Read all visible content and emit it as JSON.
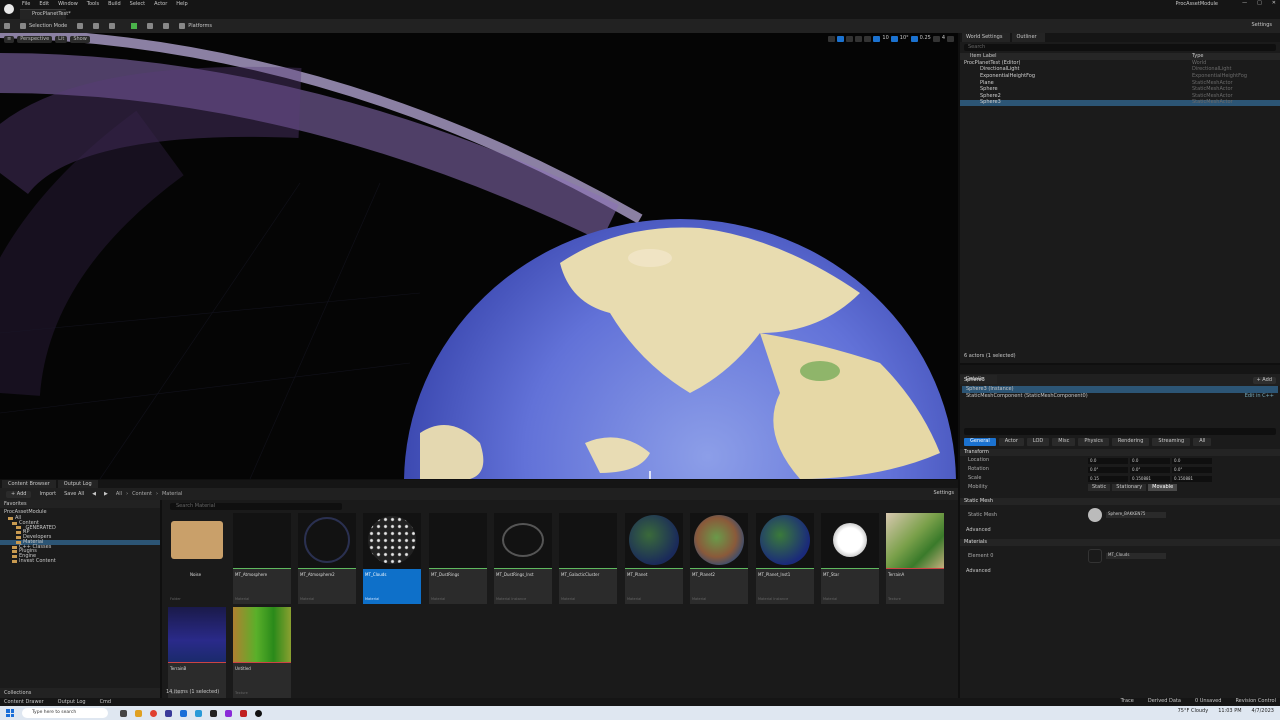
{
  "menubar": {
    "items": [
      "File",
      "Edit",
      "Window",
      "Tools",
      "Build",
      "Select",
      "Actor",
      "Help"
    ],
    "project_name": "ProcAssetModule"
  },
  "doc_tab": "ProcPlanetTest*",
  "toolbar": {
    "mode": "Selection Mode",
    "platforms": "Platforms",
    "settings": "Settings"
  },
  "viewport": {
    "perspective": "Perspective",
    "lit": "Lit",
    "show": "Show",
    "fov": "0.25",
    "grid": "10",
    "angle": "10°",
    "scale": "0.25",
    "speed": "4"
  },
  "outliner": {
    "tabs": [
      "World Settings",
      "Outliner"
    ],
    "search_placeholder": "Search",
    "col_label": "Item Label",
    "col_type": "Type",
    "rows": [
      {
        "name": "ProcPlanetTest (Editor)",
        "type": "World"
      },
      {
        "name": "DirectionalLight",
        "type": "DirectionalLight"
      },
      {
        "name": "ExponentialHeightFog",
        "type": "ExponentialHeightFog"
      },
      {
        "name": "Plane",
        "type": "StaticMeshActor"
      },
      {
        "name": "Sphere",
        "type": "StaticMeshActor"
      },
      {
        "name": "Sphere2",
        "type": "StaticMeshActor"
      },
      {
        "name": "Sphere3",
        "type": "StaticMeshActor"
      }
    ],
    "footer": "6 actors (1 selected)"
  },
  "details": {
    "tab": "Details",
    "actor": "Sphere3",
    "add": "+ Add",
    "instance": "Sphere3 (Instance)",
    "component": "StaticMeshComponent (StaticMeshComponent0)",
    "edit_cpp": "Edit in C++",
    "categories": [
      "General",
      "Actor",
      "LOD",
      "Misc",
      "Physics",
      "Rendering",
      "Streaming",
      "All"
    ],
    "transform_title": "Transform",
    "location": {
      "label": "Location",
      "x": "0.0",
      "y": "0.0",
      "z": "0.0"
    },
    "rotation": {
      "label": "Rotation",
      "x": "0.0°",
      "y": "0.0°",
      "z": "0.0°"
    },
    "scale": {
      "label": "Scale",
      "x": "0.15",
      "y": "0.150881",
      "z": "0.150881"
    },
    "mobility": {
      "label": "Mobility",
      "options": [
        "Static",
        "Stationary",
        "Movable"
      ]
    },
    "static_mesh_title": "Static Mesh",
    "static_mesh_label": "Static Mesh",
    "static_mesh_value": "Sphere_BAKKEN75",
    "advanced": "Advanced",
    "materials_title": "Materials",
    "element0": "Element 0",
    "element0_value": "MT_Clouds",
    "advanced2": "Advanced"
  },
  "content_browser": {
    "tabs": [
      "Content Browser",
      "Output Log"
    ],
    "add": "+ Add",
    "import": "Import",
    "save_all": "Save All",
    "crumbs": [
      "All",
      "Content",
      "Material"
    ],
    "settings": "Settings",
    "favorites": "Favorites",
    "project": "ProcAssetModule",
    "tree": [
      "All",
      "Content",
      "_GENERATED",
      "RP",
      "Developers",
      "Material",
      "C++ Classes",
      "Plugins",
      "Engine",
      "Invest Content"
    ],
    "search_placeholder": "Search Material",
    "collections": "Collections",
    "item_count": "14 items (1 selected)",
    "assets": [
      {
        "name": "Noise",
        "type": "Folder"
      },
      {
        "name": "MT_Atmosphere",
        "type": "Material"
      },
      {
        "name": "MT_Atmosphere2",
        "type": "Material"
      },
      {
        "name": "MT_Clouds",
        "type": "Material"
      },
      {
        "name": "MT_DustRings",
        "type": "Material"
      },
      {
        "name": "MT_DustRings_Inst",
        "type": "Material Instance"
      },
      {
        "name": "MT_GalacticCluster",
        "type": "Material"
      },
      {
        "name": "MT_Planet",
        "type": "Material"
      },
      {
        "name": "MT_Planet2",
        "type": "Material"
      },
      {
        "name": "MT_Planet_Inst1",
        "type": "Material Instance"
      },
      {
        "name": "MT_Star",
        "type": "Material"
      },
      {
        "name": "TerrainA",
        "type": "Texture"
      },
      {
        "name": "TerrainB",
        "type": "Texture"
      },
      {
        "name": "Untitled",
        "type": "Texture"
      }
    ]
  },
  "status": {
    "left": [
      "Content Drawer",
      "Output Log",
      "Cmd"
    ],
    "right": [
      "Trace",
      "Derived Data",
      "0 Unsaved",
      "Revision Control"
    ]
  },
  "taskbar": {
    "search": "Type here to search",
    "weather": "75°F Cloudy",
    "time": "11:03 PM",
    "date": "4/7/2023"
  }
}
